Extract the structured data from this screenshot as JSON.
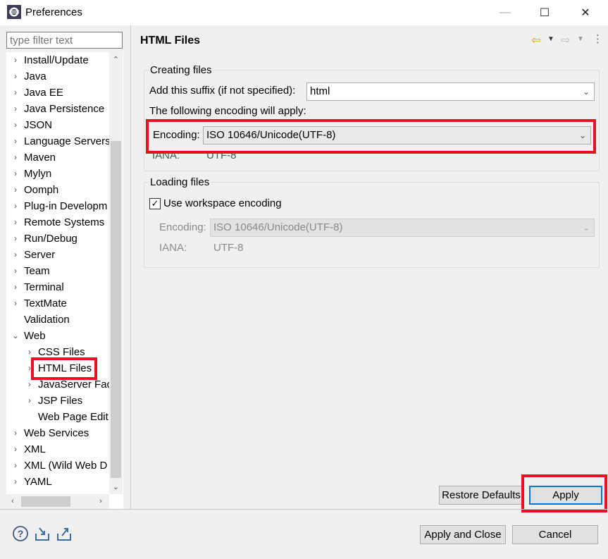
{
  "window": {
    "title": "Preferences",
    "minimize_glyph": "—",
    "maximize_glyph": "☐",
    "close_glyph": "✕"
  },
  "filter": {
    "placeholder": "type filter text",
    "value": ""
  },
  "tree": {
    "items": [
      {
        "label": "Install/Update",
        "level": 0,
        "arrow": "›"
      },
      {
        "label": "Java",
        "level": 0,
        "arrow": "›"
      },
      {
        "label": "Java EE",
        "level": 0,
        "arrow": "›"
      },
      {
        "label": "Java Persistence",
        "level": 0,
        "arrow": "›"
      },
      {
        "label": "JSON",
        "level": 0,
        "arrow": "›"
      },
      {
        "label": "Language Servers",
        "level": 0,
        "arrow": "›"
      },
      {
        "label": "Maven",
        "level": 0,
        "arrow": "›"
      },
      {
        "label": "Mylyn",
        "level": 0,
        "arrow": "›"
      },
      {
        "label": "Oomph",
        "level": 0,
        "arrow": "›"
      },
      {
        "label": "Plug-in Developm",
        "level": 0,
        "arrow": "›"
      },
      {
        "label": "Remote Systems",
        "level": 0,
        "arrow": "›"
      },
      {
        "label": "Run/Debug",
        "level": 0,
        "arrow": "›"
      },
      {
        "label": "Server",
        "level": 0,
        "arrow": "›"
      },
      {
        "label": "Team",
        "level": 0,
        "arrow": "›"
      },
      {
        "label": "Terminal",
        "level": 0,
        "arrow": "›"
      },
      {
        "label": "TextMate",
        "level": 0,
        "arrow": "›"
      },
      {
        "label": "Validation",
        "level": 0,
        "arrow": ""
      },
      {
        "label": "Web",
        "level": 0,
        "arrow": "⌄"
      },
      {
        "label": "CSS Files",
        "level": 1,
        "arrow": "›"
      },
      {
        "label": "HTML Files",
        "level": 1,
        "arrow": "›",
        "selected": true
      },
      {
        "label": "JavaServer Face",
        "level": 1,
        "arrow": "›"
      },
      {
        "label": "JSP Files",
        "level": 1,
        "arrow": "›"
      },
      {
        "label": "Web Page Edit",
        "level": 1,
        "arrow": ""
      },
      {
        "label": "Web Services",
        "level": 0,
        "arrow": "›"
      },
      {
        "label": "XML",
        "level": 0,
        "arrow": "›"
      },
      {
        "label": "XML (Wild Web D",
        "level": 0,
        "arrow": "›"
      },
      {
        "label": "YAML",
        "level": 0,
        "arrow": "›"
      }
    ]
  },
  "page": {
    "title": "HTML Files",
    "creating": {
      "group_title": "Creating files",
      "suffix_label": "Add this suffix (if not specified):",
      "suffix_value": "html",
      "encoding_intro": "The following encoding will apply:",
      "encoding_label": "Encoding:",
      "encoding_value": "ISO 10646/Unicode(UTF-8)",
      "iana_label": "IANA:",
      "iana_value": "UTF-8"
    },
    "loading": {
      "group_title": "Loading files",
      "use_workspace_label": "Use workspace encoding",
      "use_workspace_checked": true,
      "encoding_label": "Encoding:",
      "encoding_value": "ISO 10646/Unicode(UTF-8)",
      "iana_label": "IANA:",
      "iana_value": "UTF-8"
    },
    "restore_defaults_label": "Restore Defaults",
    "apply_label": "Apply"
  },
  "footer": {
    "apply_close_label": "Apply and Close",
    "cancel_label": "Cancel",
    "icons": [
      "help-icon",
      "import-icon",
      "export-icon"
    ]
  },
  "colors": {
    "highlight": "#e81123",
    "focus": "#0078d7",
    "back_arrow": "#e0a000"
  }
}
